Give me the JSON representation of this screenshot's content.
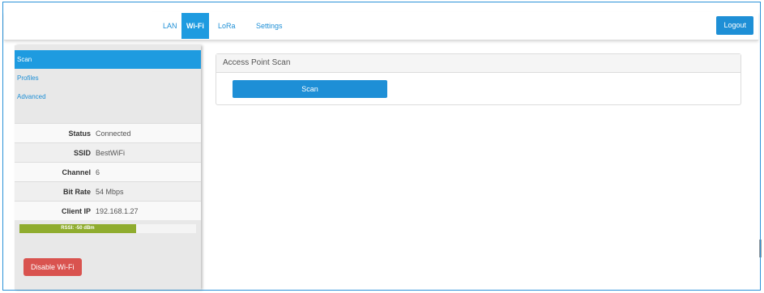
{
  "nav": {
    "tabs": [
      {
        "label": "LAN"
      },
      {
        "label": "Wi-Fi"
      },
      {
        "label": "LoRa"
      },
      {
        "label": "Settings"
      }
    ],
    "logout_label": "Logout"
  },
  "sidebar": {
    "items": [
      {
        "label": "Scan"
      },
      {
        "label": "Profiles"
      },
      {
        "label": "Advanced"
      }
    ],
    "stats": [
      {
        "label": "Status",
        "value": "Connected"
      },
      {
        "label": "SSID",
        "value": "BestWiFi"
      },
      {
        "label": "Channel",
        "value": "6"
      },
      {
        "label": "Bit Rate",
        "value": "54 Mbps"
      },
      {
        "label": "Client IP",
        "value": "192.168.1.27"
      }
    ],
    "rssi": {
      "label": "RSSI: -50 dBm",
      "fill_percent": 66,
      "color": "#8fac2e"
    },
    "disable_label": "Disable Wi-Fi"
  },
  "main": {
    "panel_title": "Access Point Scan",
    "scan_label": "Scan"
  },
  "colors": {
    "accent": "#1e8fd6",
    "danger": "#d9534f"
  }
}
